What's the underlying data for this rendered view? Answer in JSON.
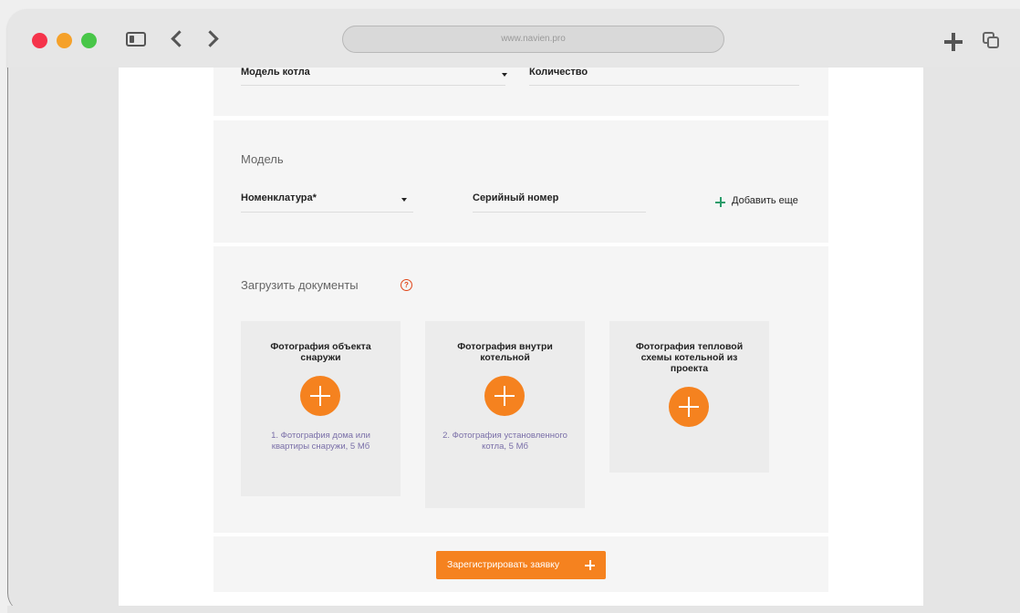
{
  "browser": {
    "url": "www.navien.pro",
    "traffic_lights": [
      "close",
      "minimize",
      "zoom"
    ],
    "colors": {
      "close": "#f5334a",
      "minimize": "#f5a12a",
      "zoom": "#48c648"
    }
  },
  "form": {
    "boiler_row": {
      "model_label": "Модель котла",
      "quantity_label": "Количество"
    },
    "model_section": {
      "title": "Модель",
      "nomenclature_label": "Номенклатура*",
      "serial_label": "Серийный номер",
      "add_more_label": "Добавить еще"
    },
    "documents_section": {
      "title": "Загрузить документы",
      "help_symbol": "?",
      "cards": [
        {
          "title": "Фотография объекта снаружи",
          "hint": "1. Фотография дома или квартиры снаружи, 5 Мб"
        },
        {
          "title": "Фотография внутри котельной",
          "hint": "2. Фотография установленного котла, 5 Мб"
        },
        {
          "title": "Фотография тепловой схемы котельной из проекта",
          "hint": ""
        }
      ]
    },
    "submit_label": "Зарегистрировать заявку",
    "accent_color": "#f5821f",
    "add_color": "#2a9c6a",
    "help_color": "#e0461a"
  }
}
